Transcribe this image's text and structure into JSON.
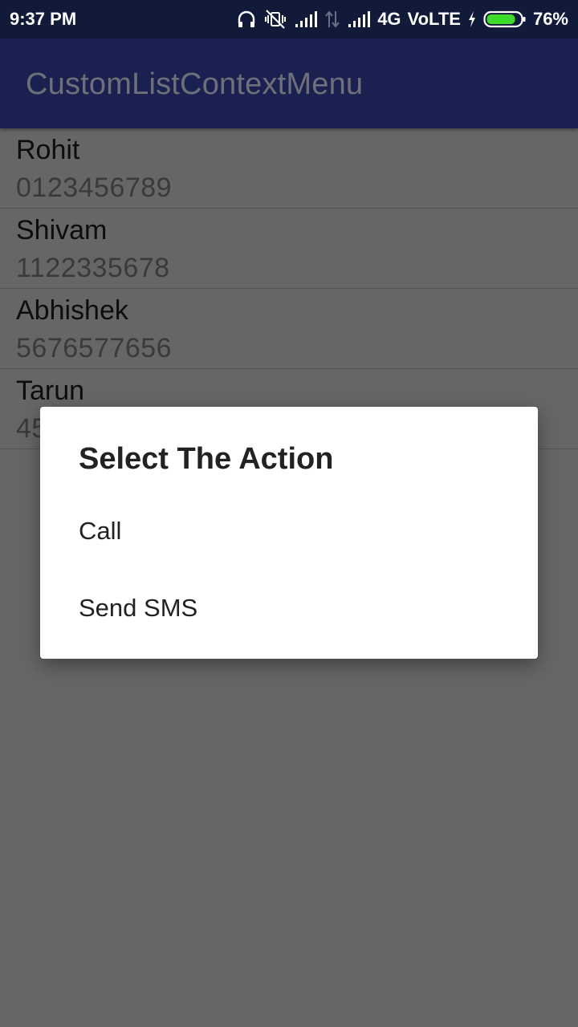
{
  "status_bar": {
    "time": "9:37 PM",
    "network": "4G",
    "volte": "VoLTE",
    "battery": "76%",
    "icons": [
      "headphones-icon",
      "vibrate-off-icon",
      "signal-icon",
      "data-arrows-icon",
      "signal-icon",
      "charging-bolt-icon",
      "battery-icon"
    ]
  },
  "app_bar": {
    "title": "CustomListContextMenu"
  },
  "contacts": [
    {
      "name": "Rohit",
      "phone": "0123456789"
    },
    {
      "name": "Shivam",
      "phone": "1122335678"
    },
    {
      "name": "Abhishek",
      "phone": "5676577656"
    },
    {
      "name": "Tarun",
      "phone": "45"
    }
  ],
  "dialog": {
    "title": "Select The Action",
    "options": [
      "Call",
      "Send SMS"
    ]
  },
  "colors": {
    "status_bar": "#121a3a",
    "app_bar": "#1a2150",
    "scrim_background": "#666666",
    "battery_fill": "#3ddc2b"
  }
}
